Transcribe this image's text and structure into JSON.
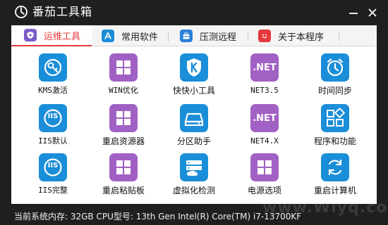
{
  "window": {
    "title": "番茄工具箱",
    "minimize_symbol": "—",
    "close_symbol": "✕"
  },
  "tabs": [
    {
      "label": "运维工具",
      "icon": "shield-icon",
      "active": true
    },
    {
      "label": "常用软件",
      "icon": "app-store-icon",
      "active": false
    },
    {
      "label": "压测远程",
      "icon": "toolbox-icon",
      "active": false
    },
    {
      "label": "关于本程序",
      "icon": "smiley-icon",
      "active": false
    }
  ],
  "tiles": [
    {
      "label": "KMS激活",
      "icon": "key-icon",
      "color": "#1a8ed8"
    },
    {
      "label": "WIN优化",
      "icon": "windows-icon",
      "color": "#a161c4"
    },
    {
      "label": "快快小工具",
      "icon": "k-shield-icon",
      "color": "#1a8ed8"
    },
    {
      "label": "NET3.5",
      "icon": "dotnet-icon",
      "icon_text": ".NET",
      "color": "#a161c4"
    },
    {
      "label": "时间同步",
      "icon": "alarm-clock-icon",
      "color": "#1a8ed8"
    },
    {
      "label": "IIS默认",
      "icon": "iis-icon",
      "icon_text": "IIS",
      "color": "#1a8ed8"
    },
    {
      "label": "重启资源器",
      "icon": "windows-icon",
      "color": "#a161c4"
    },
    {
      "label": "分区助手",
      "icon": "disk-icon",
      "color": "#1a8ed8"
    },
    {
      "label": "NET4.X",
      "icon": "dotnet-icon",
      "icon_text": ".NET",
      "color": "#a161c4"
    },
    {
      "label": "程序和功能",
      "icon": "apps-grid-icon",
      "color": "#1a8ed8"
    },
    {
      "label": "IIS完整",
      "icon": "iis-icon",
      "icon_text": "IIS",
      "color": "#1a8ed8"
    },
    {
      "label": "重启粘贴板",
      "icon": "windows-icon",
      "color": "#a161c4"
    },
    {
      "label": "虚拟化检测",
      "icon": "server-cloud-icon",
      "color": "#1a8ed8"
    },
    {
      "label": "电源选项",
      "icon": "windows-icon",
      "color": "#a161c4"
    },
    {
      "label": "重启计算机",
      "icon": "refresh-icon",
      "color": "#1a8ed8"
    }
  ],
  "status": {
    "text": "当前系统内存: 32GB CPU型号: 13th Gen Intel(R) Core(TM) i7-13700KF"
  },
  "watermark": {
    "text": "www.Wiyq.com"
  },
  "colors": {
    "accent_red": "#e4393c",
    "tile_blue": "#1a8ed8",
    "tile_purple": "#a161c4",
    "frame_dark": "#1f1f1f"
  }
}
